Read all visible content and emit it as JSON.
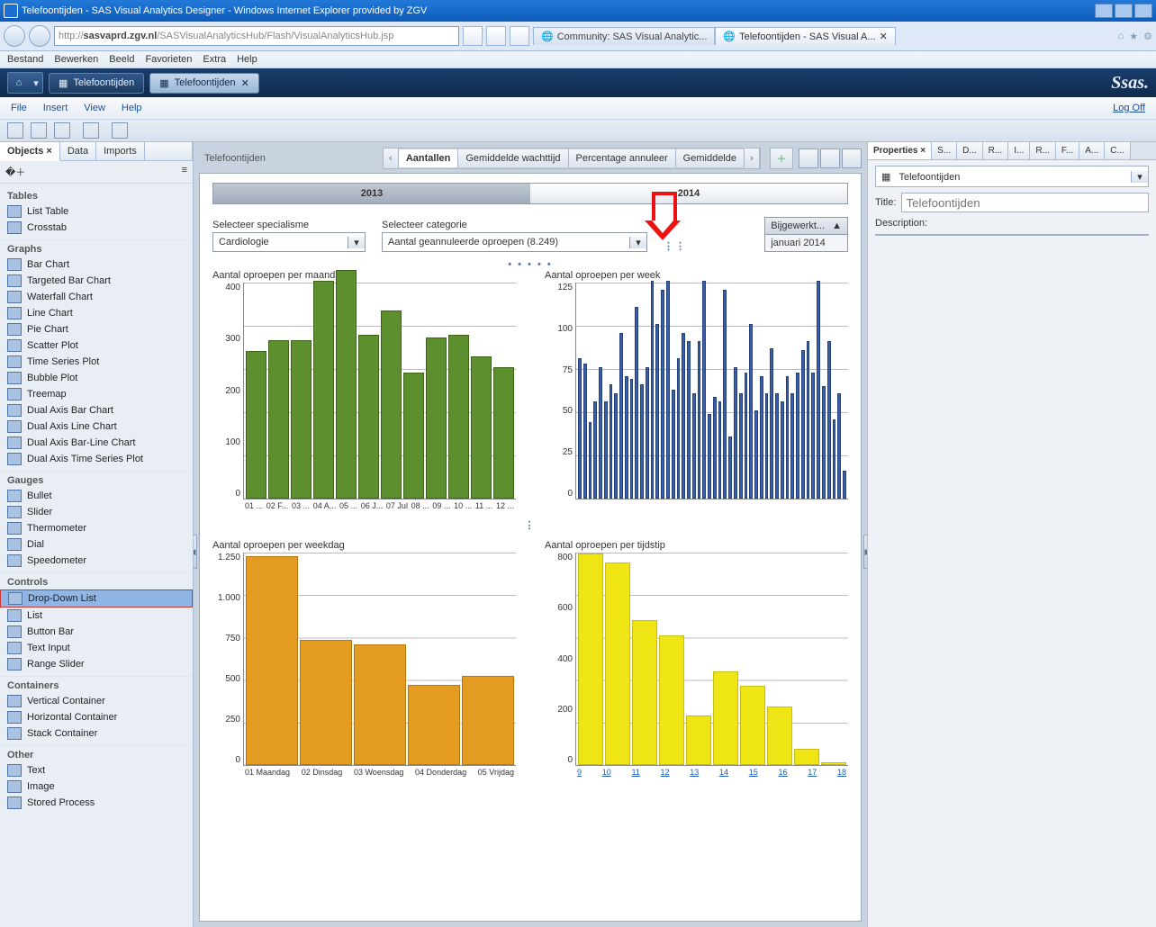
{
  "window": {
    "title": "Telefoontijden - SAS Visual Analytics Designer - Windows Internet Explorer provided by ZGV",
    "url_host": "http://",
    "url_bold": "sasvaprd.zgv.nl",
    "url_path": "/SASVisualAnalyticsHub/Flash/VisualAnalyticsHub.jsp",
    "browser_tabs": [
      "Community: SAS Visual Analytic...",
      "Telefoontijden - SAS Visual A..."
    ],
    "ie_menu": [
      "Bestand",
      "Bewerken",
      "Beeld",
      "Favorieten",
      "Extra",
      "Help"
    ]
  },
  "app": {
    "tabs": [
      "Telefoontijden",
      "Telefoontijden"
    ],
    "menu": [
      "File",
      "Insert",
      "View",
      "Help"
    ],
    "logoff": "Log Off",
    "logo": "Ssas."
  },
  "left": {
    "tabs": [
      "Objects",
      "Data",
      "Imports"
    ],
    "sections": {
      "tables": {
        "label": "Tables",
        "items": [
          "List Table",
          "Crosstab"
        ]
      },
      "graphs": {
        "label": "Graphs",
        "items": [
          "Bar Chart",
          "Targeted Bar Chart",
          "Waterfall Chart",
          "Line Chart",
          "Pie Chart",
          "Scatter Plot",
          "Time Series Plot",
          "Bubble Plot",
          "Treemap",
          "Dual Axis Bar Chart",
          "Dual Axis Line Chart",
          "Dual Axis Bar-Line Chart",
          "Dual Axis Time Series Plot"
        ]
      },
      "gauges": {
        "label": "Gauges",
        "items": [
          "Bullet",
          "Slider",
          "Thermometer",
          "Dial",
          "Speedometer"
        ]
      },
      "controls": {
        "label": "Controls",
        "items": [
          "Drop-Down List",
          "List",
          "Button Bar",
          "Text Input",
          "Range Slider"
        ]
      },
      "containers": {
        "label": "Containers",
        "items": [
          "Vertical Container",
          "Horizontal Container",
          "Stack Container"
        ]
      },
      "other": {
        "label": "Other",
        "items": [
          "Text",
          "Image",
          "Stored Process"
        ]
      }
    },
    "selected": "Drop-Down List"
  },
  "report": {
    "breadcrumb": "Telefoontijden",
    "tabs": [
      "Aantallen",
      "Gemiddelde wachttijd",
      "Percentage annuleer",
      "Gemiddelde"
    ],
    "active_tab": 0,
    "years": [
      "2013",
      "2014"
    ],
    "filter_special": {
      "label": "Selecteer specialisme",
      "value": "Cardiologie"
    },
    "filter_cat": {
      "label": "Selecteer categorie",
      "value": "Aantal geannuleerde oproepen (8.249)"
    },
    "bijgewerkt": {
      "label": "Bijgewerkt...",
      "value": "januari 2014"
    }
  },
  "chart_data": [
    {
      "name": "maand",
      "type": "bar",
      "title": "Aantal oproepen per maand",
      "ylim": [
        0,
        400
      ],
      "yticks": [
        "0",
        "100",
        "200",
        "300",
        "400"
      ],
      "categories": [
        "01 ...",
        "02 F...",
        "03 ...",
        "04 A...",
        "05 ...",
        "06 J...",
        "07 Jul",
        "08 ...",
        "09 ...",
        "10 ...",
        "11 ...",
        "12 ..."
      ],
      "values": [
        270,
        290,
        290,
        400,
        420,
        300,
        345,
        230,
        295,
        300,
        260,
        240
      ]
    },
    {
      "name": "week",
      "type": "bar",
      "title": "Aantal oproepen per week",
      "ylim": [
        0,
        125
      ],
      "yticks": [
        "0",
        "25",
        "50",
        "75",
        "100",
        "125"
      ],
      "categories": [],
      "values": [
        80,
        77,
        43,
        55,
        75,
        55,
        65,
        60,
        95,
        70,
        68,
        110,
        65,
        75,
        125,
        100,
        120,
        125,
        62,
        80,
        95,
        90,
        60,
        90,
        125,
        48,
        58,
        55,
        120,
        35,
        75,
        60,
        72,
        100,
        50,
        70,
        60,
        86,
        60,
        55,
        70,
        60,
        72,
        85,
        90,
        72,
        125,
        64,
        90,
        45,
        60,
        15
      ]
    },
    {
      "name": "weekdag",
      "type": "bar",
      "title": "Aantal oproepen per weekdag",
      "ylim": [
        0,
        1250
      ],
      "yticks": [
        "0",
        "250",
        "500",
        "750",
        "1.000",
        "1.250"
      ],
      "categories": [
        "01 Maandag",
        "02 Dinsdag",
        "03 Woensdag",
        "04 Donderdag",
        "05 Vrijdag"
      ],
      "values": [
        1220,
        725,
        700,
        460,
        515
      ]
    },
    {
      "name": "tijdstip",
      "type": "bar",
      "title": "Aantal oproepen per tijdstip",
      "ylim": [
        0,
        800
      ],
      "yticks": [
        "0",
        "200",
        "400",
        "600",
        "800"
      ],
      "categories": [
        "9",
        "10",
        "11",
        "12",
        "13",
        "14",
        "15",
        "16",
        "17",
        "18"
      ],
      "values": [
        790,
        755,
        540,
        480,
        180,
        345,
        290,
        215,
        55,
        5
      ]
    }
  ],
  "right": {
    "tabs": [
      "Properties",
      "S...",
      "D...",
      "R...",
      "I...",
      "R...",
      "F...",
      "A...",
      "C..."
    ],
    "context": "Telefoontijden",
    "title_label": "Title:",
    "title_value": "Telefoontijden",
    "desc_label": "Description:"
  }
}
